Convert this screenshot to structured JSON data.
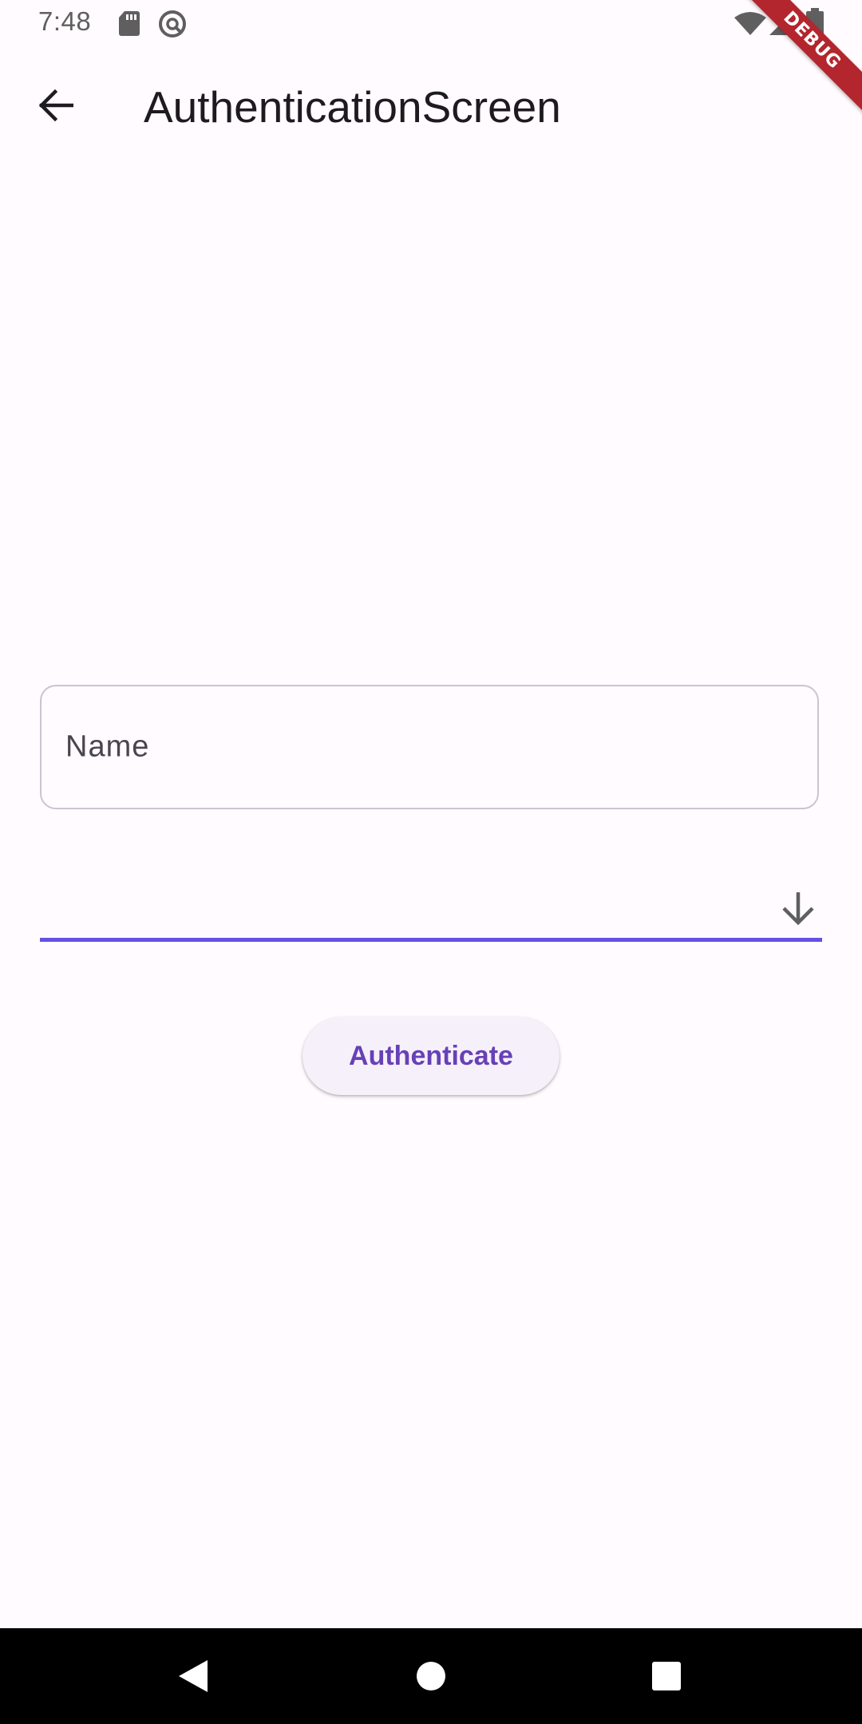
{
  "status_bar": {
    "time": "7:48",
    "icons": [
      "sd-card-icon",
      "do-not-disturb-icon",
      "wifi-icon",
      "cell-signal-icon",
      "battery-icon"
    ]
  },
  "debug_banner": {
    "label": "DEBUG",
    "color": "#b3262d"
  },
  "app_bar": {
    "title": "AuthenticationScreen",
    "back_icon": "arrow-back-icon"
  },
  "form": {
    "name_field": {
      "label": "Name",
      "value": ""
    },
    "dropdown": {
      "selected": "",
      "icon": "arrow-down-icon",
      "accent_color": "#6750e4"
    },
    "submit_button": {
      "label": "Authenticate",
      "text_color": "#6741b6"
    }
  },
  "nav_bar": {
    "items": [
      "back-nav-icon",
      "home-nav-icon",
      "recents-nav-icon"
    ]
  }
}
